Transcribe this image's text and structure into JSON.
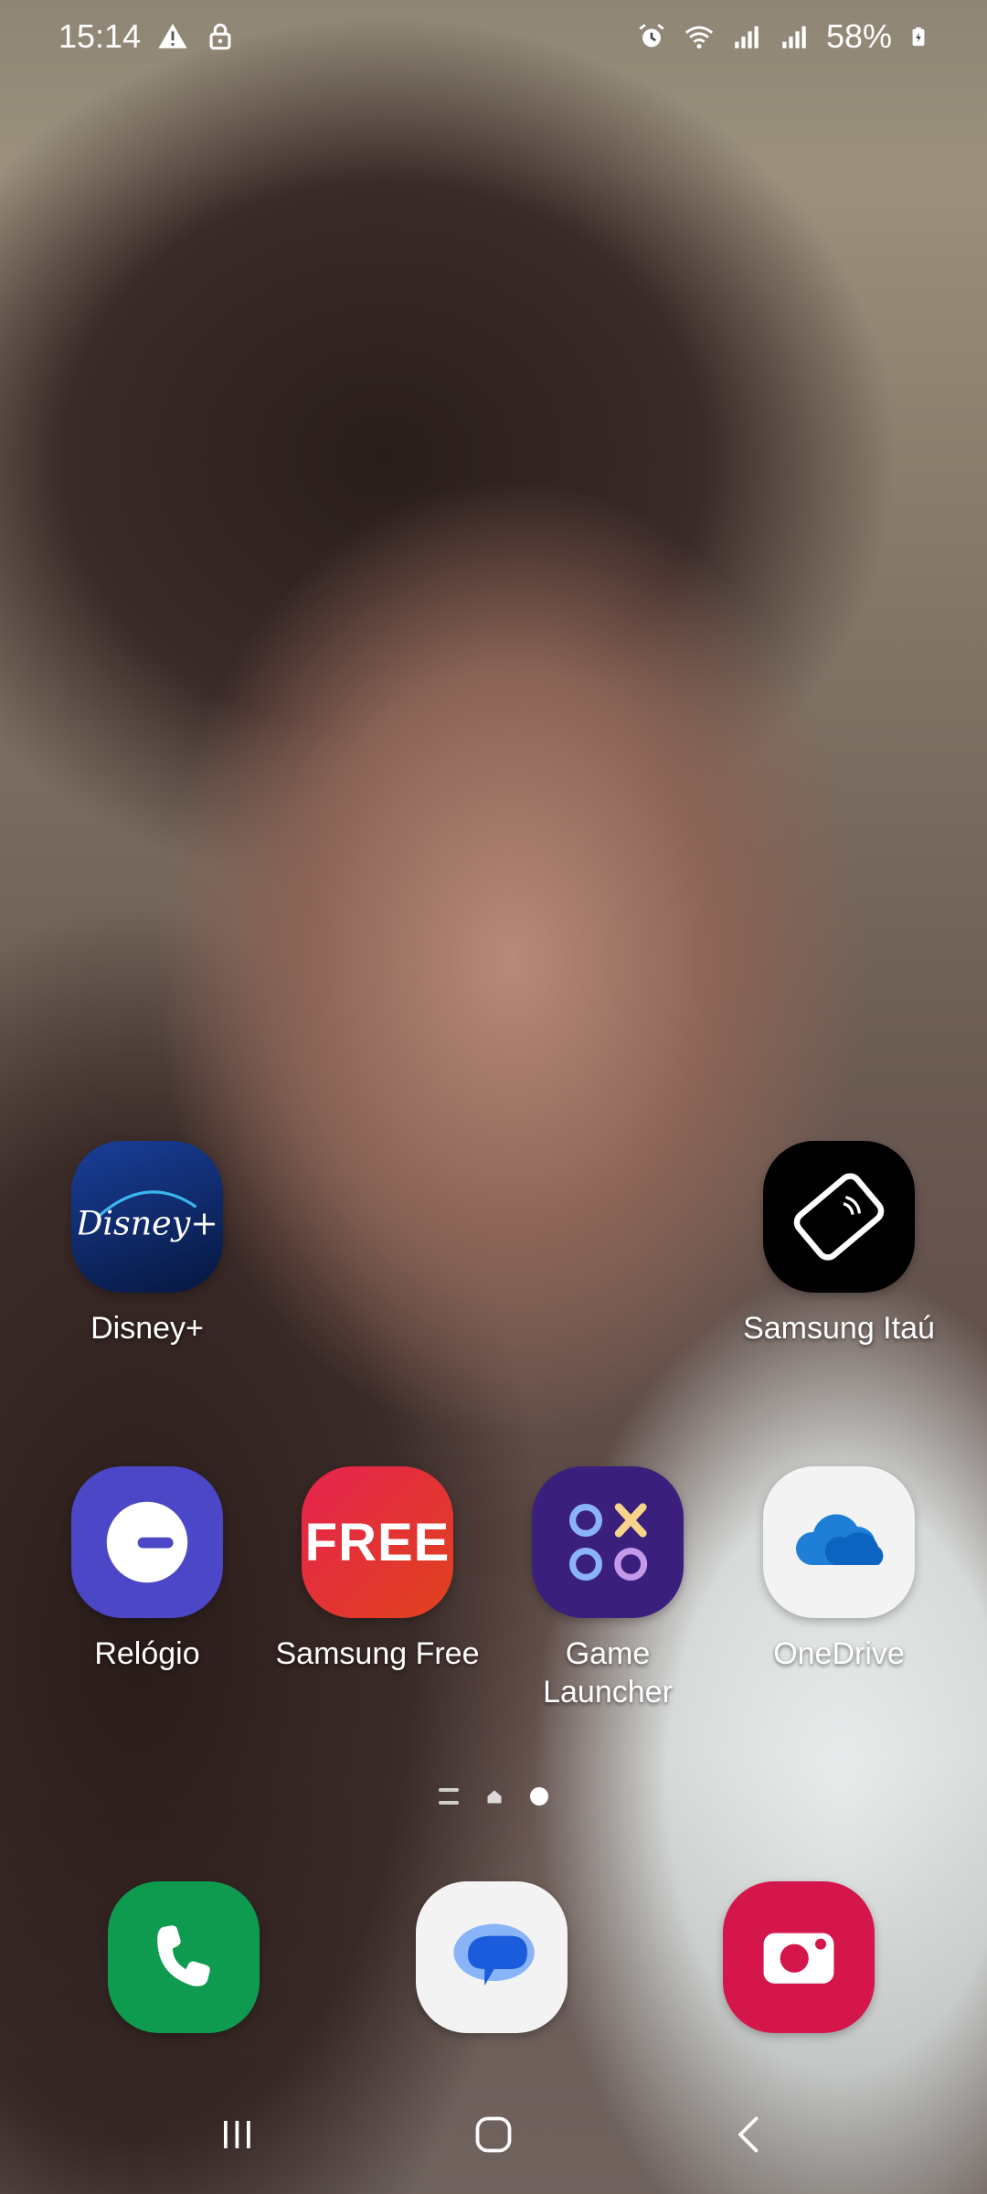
{
  "status_bar": {
    "time": "15:14",
    "battery": "58%",
    "left_icons": [
      "warning-icon",
      "lock-icon"
    ],
    "right_icons": [
      "alarm-icon",
      "wifi-icon",
      "signal-1-icon",
      "signal-2-icon",
      "battery-icon"
    ]
  },
  "apps": {
    "disney": {
      "label": "Disney+",
      "icon": "disney-plus-icon",
      "color": "#0b2b6e"
    },
    "samsung_itau": {
      "label": "Samsung Itaú",
      "icon": "card-tap-icon",
      "color": "#000000"
    },
    "relogio": {
      "label": "Relógio",
      "icon": "clock-icon",
      "color": "#4b47c7"
    },
    "samsung_free": {
      "label": "Samsung Free",
      "icon": "free-icon",
      "icon_text": "FREE",
      "color": "#e5264e"
    },
    "game_launcher": {
      "label": "Game\nLauncher",
      "label_line1": "Game",
      "label_line2": "Launcher",
      "icon": "game-launcher-icon",
      "color": "#3a1f7a"
    },
    "onedrive": {
      "label": "OneDrive",
      "icon": "cloud-icon",
      "color": "#f2f2f2"
    }
  },
  "pager": {
    "pages": 3,
    "active_index": 2
  },
  "dock": [
    {
      "name": "phone",
      "icon": "phone-icon",
      "color": "#0d9b4f"
    },
    {
      "name": "messages",
      "icon": "chat-bubble-icon",
      "color": "#f2f2f2"
    },
    {
      "name": "camera",
      "icon": "camera-icon",
      "color": "#d4164a"
    }
  ],
  "nav": [
    "recents-icon",
    "home-icon",
    "back-icon"
  ]
}
